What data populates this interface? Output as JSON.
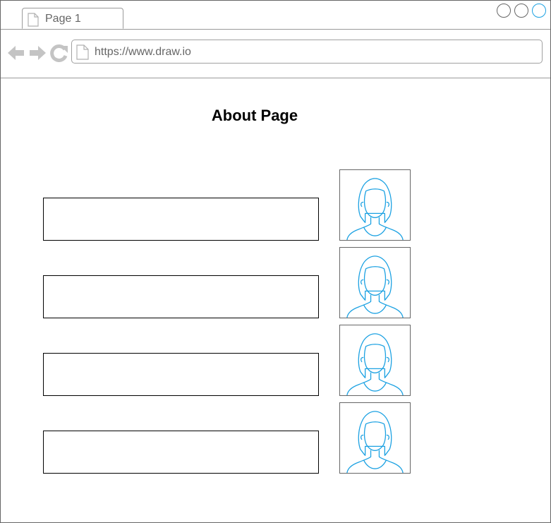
{
  "browser": {
    "tab": {
      "label": "Page 1",
      "icon": "document-icon"
    },
    "window_buttons": [
      "minimize",
      "maximize",
      "close"
    ],
    "nav": {
      "back_icon": "back-arrow-icon",
      "forward_icon": "forward-arrow-icon",
      "reload_icon": "reload-icon"
    },
    "url": "https://www.draw.io"
  },
  "page": {
    "title": "About Page",
    "rows": [
      {
        "text": "",
        "avatar": "female-avatar-icon"
      },
      {
        "text": "",
        "avatar": "female-avatar-icon"
      },
      {
        "text": "",
        "avatar": "female-avatar-icon"
      },
      {
        "text": "",
        "avatar": "female-avatar-icon"
      }
    ]
  },
  "colors": {
    "chrome_gray": "#c4c4c4",
    "border": "#666666",
    "avatar_stroke": "#1ba1e2",
    "active_window_button": "#1ba1e2"
  }
}
